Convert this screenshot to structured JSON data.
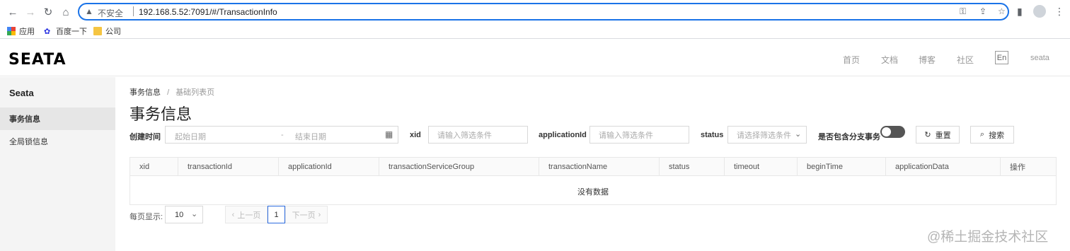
{
  "browser": {
    "url_insecure_label": "不安全",
    "url": "192.168.5.52:7091/#/TransactionInfo",
    "bookmarks": [
      {
        "label": "应用"
      },
      {
        "label": "百度一下"
      },
      {
        "label": "公司"
      }
    ]
  },
  "header": {
    "logo": "SEATA",
    "nav": [
      "首页",
      "文档",
      "博客",
      "社区"
    ],
    "lang": "En",
    "user": "seata"
  },
  "sidebar": {
    "title": "Seata",
    "items": [
      {
        "label": "事务信息",
        "active": true
      },
      {
        "label": "全局锁信息",
        "active": false
      }
    ]
  },
  "breadcrumb": {
    "current": "事务信息",
    "separator": "/",
    "parent": "基础列表页"
  },
  "page_title": "事务信息",
  "filters": {
    "create_time_label": "创建时间",
    "start_date_placeholder": "起始日期",
    "range_separator": "-",
    "end_date_placeholder": "结束日期",
    "xid_label": "xid",
    "xid_placeholder": "请输入筛选条件",
    "application_label": "applicationId",
    "application_placeholder": "请输入筛选条件",
    "status_label": "status",
    "status_placeholder": "请选择筛选条件",
    "branch_label": "是否包含分支事务",
    "branch_toggle_on": false,
    "reset_label": "重置",
    "search_label": "搜索"
  },
  "table": {
    "columns": [
      "xid",
      "transactionId",
      "applicationId",
      "transactionServiceGroup",
      "transactionName",
      "status",
      "timeout",
      "beginTime",
      "applicationData",
      "操作"
    ],
    "empty_text": "没有数据"
  },
  "pagination": {
    "page_size_label": "每页显示:",
    "page_size": "10",
    "prev_label": "上一页",
    "current_page": "1",
    "next_label": "下一页"
  },
  "watermark": "@稀土掘金技术社区",
  "colors": {
    "accent": "#1a73e8",
    "sidebar_bg": "#f4f4f4",
    "toggle_off": "#555555"
  }
}
